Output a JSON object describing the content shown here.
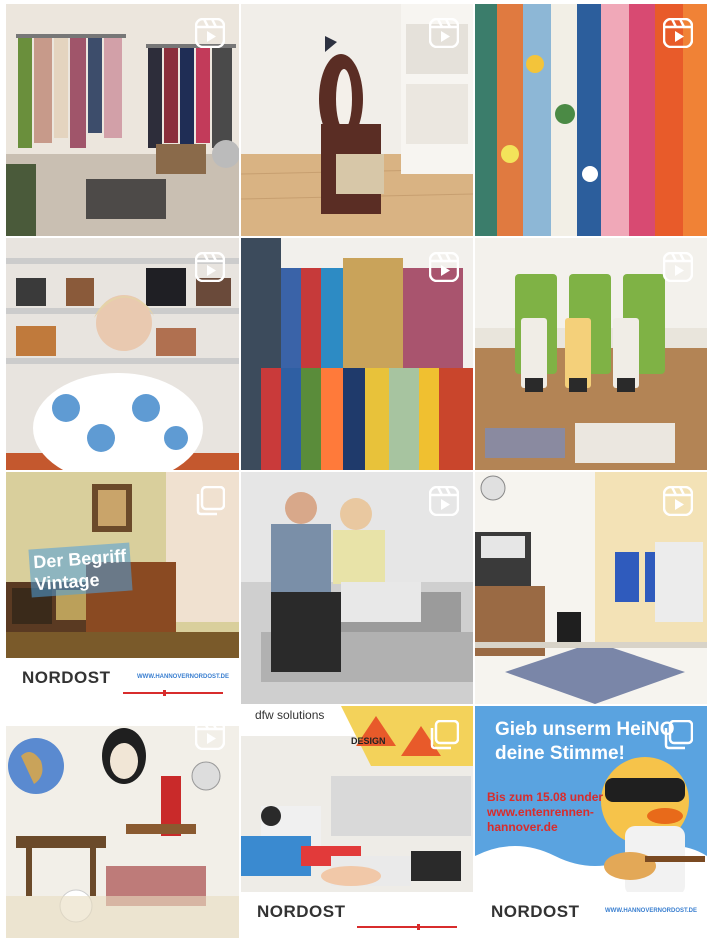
{
  "grid": {
    "posts": [
      {
        "type": "reel",
        "alt": "Clothing racks in a boutique"
      },
      {
        "type": "reel",
        "alt": "Wooden rocking horse"
      },
      {
        "type": "reel",
        "alt": "Colorful dresses on a rack"
      },
      {
        "type": "reel",
        "alt": "Woman seated at a table in front of bag shelves"
      },
      {
        "type": "reel",
        "alt": "Rack of colourful jackets"
      },
      {
        "type": "reel",
        "alt": "Cosmetics tubes on a wooden table"
      },
      {
        "type": "carousel",
        "alt": "Vintage interior with radio"
      },
      {
        "type": "reel",
        "alt": "Couple sitting on a grey sofa"
      },
      {
        "type": "reel",
        "alt": "Office room with printer and chairs"
      },
      {
        "type": "reel",
        "alt": "Vintage furniture showroom"
      },
      {
        "type": "reel",
        "alt": "Desk with design color swatches"
      },
      {
        "type": "carousel",
        "alt": "Rubber duck with sunglasses and guitar"
      }
    ]
  },
  "vintage": {
    "title_line1": "Der Begriff",
    "title_line2": "Vintage"
  },
  "brand": {
    "name": "NORDOST",
    "url": "WWW.HANNOVERNORDOST.DE",
    "url_short": "WWW.HANNOVERNORDOST.DE",
    "url_short2": "WWW.HANNOVERNORDOST.DE"
  },
  "design": {
    "logo": "dfw solutions",
    "word": "DESIGN"
  },
  "duck": {
    "line1": "Gieb unserm HeiNO",
    "line2": "deine Stimme!",
    "sub1": "Bis zum 15.08 under",
    "sub2": "www.entenrennen-",
    "sub3": "hannover.de"
  },
  "colors": {
    "brand_blue": "#3a7fd0",
    "duck_blue": "#5aa3e0",
    "accent_red": "#d82c2c"
  }
}
